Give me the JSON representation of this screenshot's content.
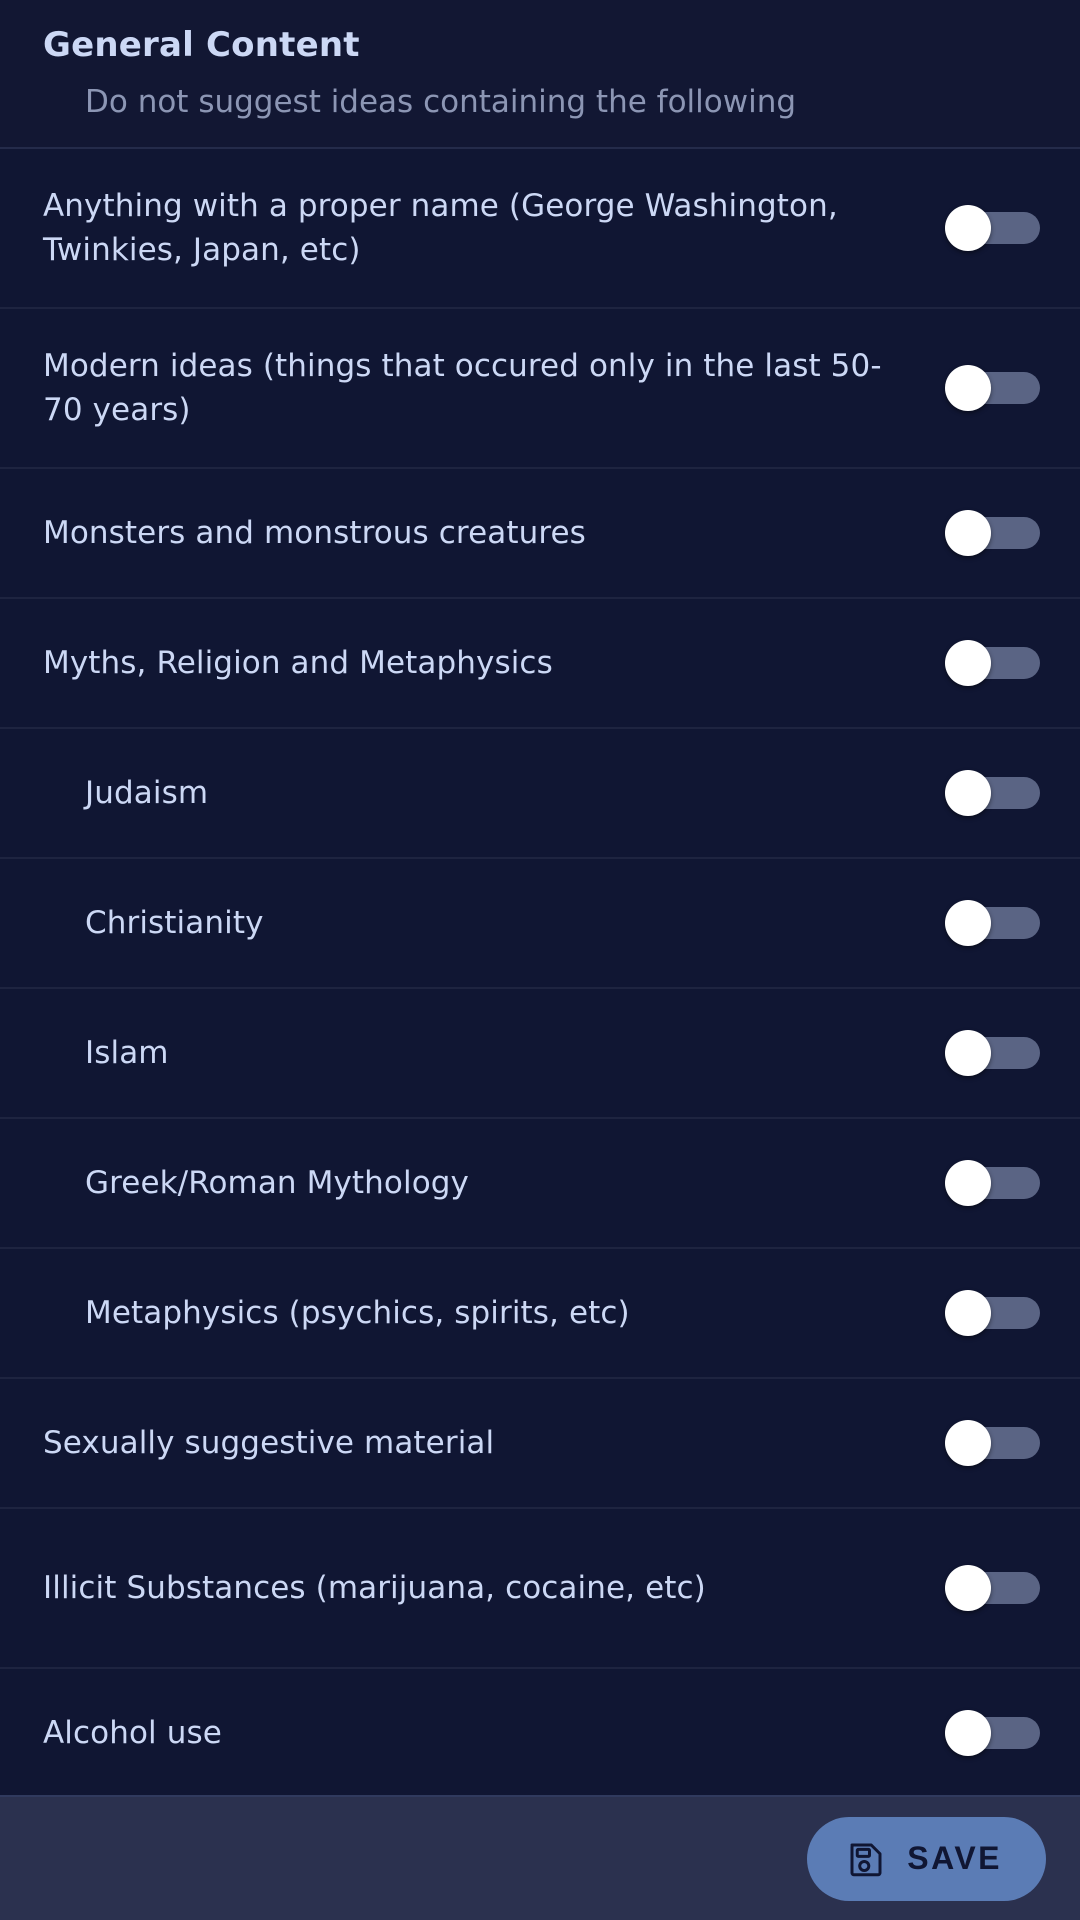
{
  "header": {
    "title": "General Content",
    "subtitle": "Do not suggest ideas containing the following"
  },
  "settings": {
    "items": [
      {
        "label": "Anything with a proper name (George Washington, Twinkies, Japan, etc)",
        "indent": false,
        "enabled": false
      },
      {
        "label": "Modern ideas (things that occured only in the last 50-70 years)",
        "indent": false,
        "enabled": false
      },
      {
        "label": "Monsters and monstrous creatures",
        "indent": false,
        "enabled": false
      },
      {
        "label": "Myths, Religion and Metaphysics",
        "indent": false,
        "enabled": false
      },
      {
        "label": "Judaism",
        "indent": true,
        "enabled": false
      },
      {
        "label": "Christianity",
        "indent": true,
        "enabled": false
      },
      {
        "label": "Islam",
        "indent": true,
        "enabled": false
      },
      {
        "label": "Greek/Roman Mythology",
        "indent": true,
        "enabled": false
      },
      {
        "label": "Metaphysics (psychics, spirits, etc)",
        "indent": true,
        "enabled": false
      },
      {
        "label": "Sexually suggestive material",
        "indent": false,
        "enabled": false
      },
      {
        "label": "Illicit Substances (marijuana, cocaine, etc)",
        "indent": false,
        "enabled": false
      },
      {
        "label": "Alcohol use",
        "indent": false,
        "enabled": false
      }
    ]
  },
  "footer": {
    "save_label": "SAVE",
    "save_icon": "floppy-disk-save-icon"
  },
  "colors": {
    "page_background": "#0e1328",
    "header_background": "#121733",
    "row_background": "#101633",
    "row_divider": "#1e2440",
    "title_text": "#ccd8f5",
    "subtitle_text": "#8c96b4",
    "label_text": "#ccd8f5",
    "toggle_track": "#5a6484",
    "toggle_knob": "#ffffff",
    "footer_background": "#2b314f",
    "save_button": "#5b7cb5",
    "save_text": "#101633"
  }
}
